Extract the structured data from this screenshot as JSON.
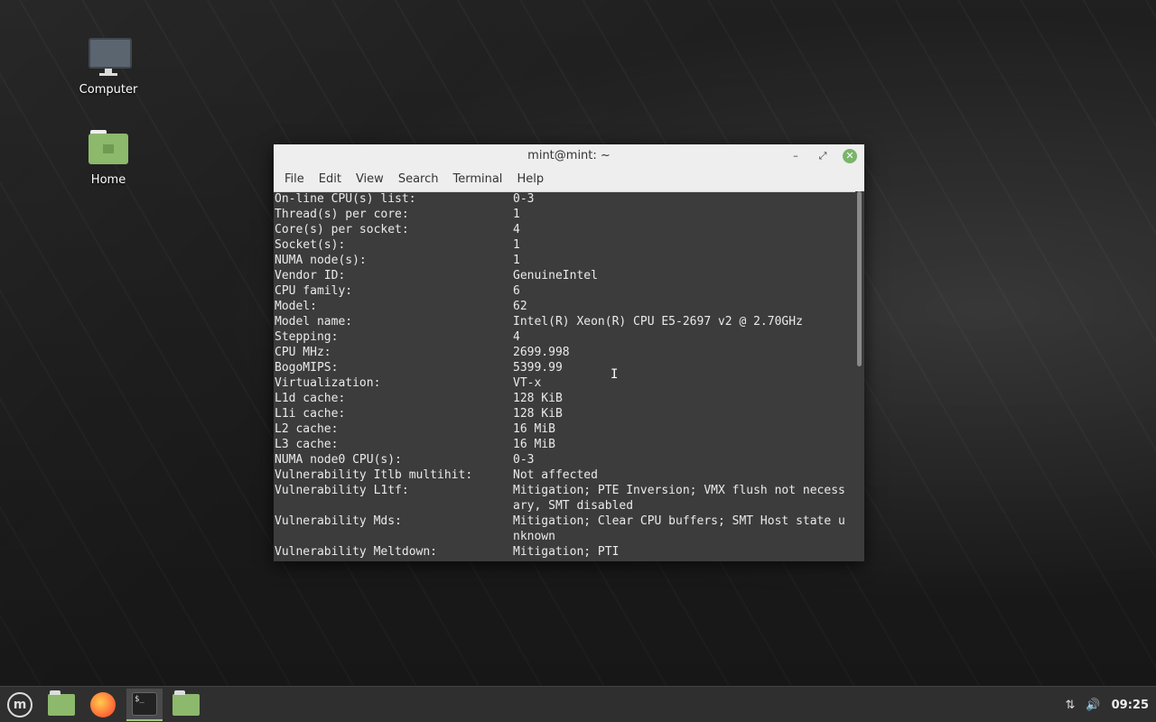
{
  "desktop": {
    "icons": [
      {
        "label": "Computer",
        "icon": "computer-icon"
      },
      {
        "label": "Home",
        "icon": "home-folder-icon"
      }
    ]
  },
  "window": {
    "title": "mint@mint: ~",
    "controls": {
      "minimize": "–",
      "maximize": "⤢",
      "close": "✕"
    },
    "menu": [
      "File",
      "Edit",
      "View",
      "Search",
      "Terminal",
      "Help"
    ]
  },
  "terminal": {
    "lines": [
      {
        "k": "On-line CPU(s) list:",
        "v": "0-3"
      },
      {
        "k": "Thread(s) per core:",
        "v": "1"
      },
      {
        "k": "Core(s) per socket:",
        "v": "4"
      },
      {
        "k": "Socket(s):",
        "v": "1"
      },
      {
        "k": "NUMA node(s):",
        "v": "1"
      },
      {
        "k": "Vendor ID:",
        "v": "GenuineIntel"
      },
      {
        "k": "CPU family:",
        "v": "6"
      },
      {
        "k": "Model:",
        "v": "62"
      },
      {
        "k": "Model name:",
        "v": "Intel(R) Xeon(R) CPU E5-2697 v2 @ 2.70GHz"
      },
      {
        "k": "Stepping:",
        "v": "4"
      },
      {
        "k": "CPU MHz:",
        "v": "2699.998"
      },
      {
        "k": "BogoMIPS:",
        "v": "5399.99"
      },
      {
        "k": "Virtualization:",
        "v": "VT-x"
      },
      {
        "k": "L1d cache:",
        "v": "128 KiB"
      },
      {
        "k": "L1i cache:",
        "v": "128 KiB"
      },
      {
        "k": "L2 cache:",
        "v": "16 MiB"
      },
      {
        "k": "L3 cache:",
        "v": "16 MiB"
      },
      {
        "k": "NUMA node0 CPU(s):",
        "v": "0-3"
      },
      {
        "k": "Vulnerability Itlb multihit:",
        "v": "Not affected"
      },
      {
        "k": "Vulnerability L1tf:",
        "v": "Mitigation; PTE Inversion; VMX flush not necess"
      },
      {
        "k": "",
        "v": "ary, SMT disabled"
      },
      {
        "k": "Vulnerability Mds:",
        "v": "Mitigation; Clear CPU buffers; SMT Host state u"
      },
      {
        "k": "",
        "v": "nknown"
      },
      {
        "k": "Vulnerability Meltdown:",
        "v": "Mitigation; PTI"
      }
    ]
  },
  "taskbar": {
    "menu_glyph": "m",
    "terminal_glyph": "$_",
    "clock": "09:25",
    "network_glyph": "⇅",
    "volume_glyph": "🔊"
  }
}
